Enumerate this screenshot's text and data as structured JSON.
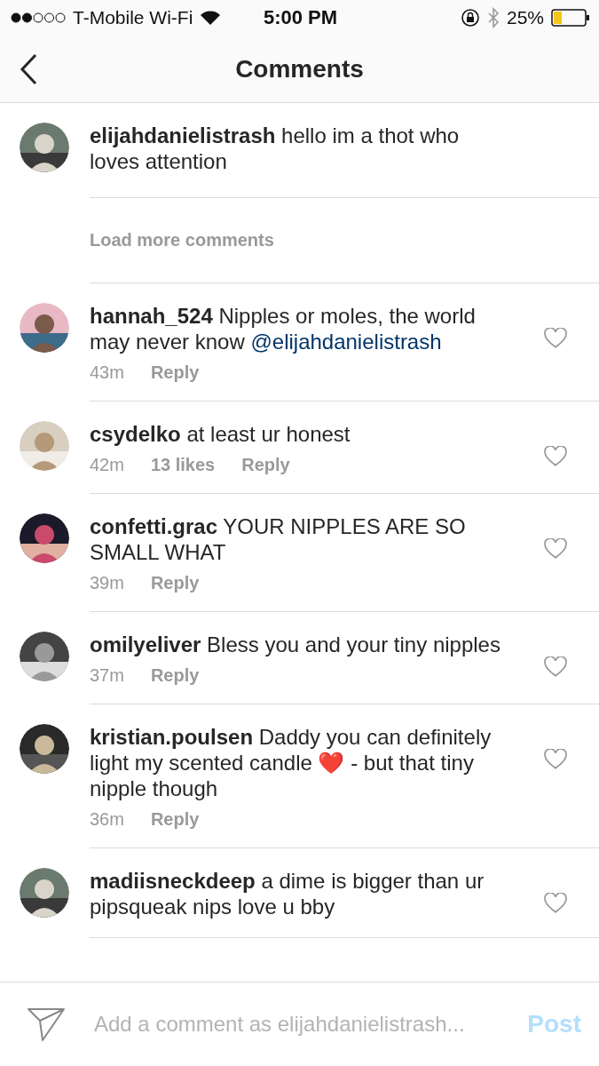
{
  "status_bar": {
    "carrier": "T-Mobile Wi-Fi",
    "time": "5:00 PM",
    "battery": "25%"
  },
  "header": {
    "title": "Comments"
  },
  "caption": {
    "username": "elijahdanielistrash",
    "text": "hello im a thot who loves attention"
  },
  "load_more": "Load more comments",
  "comments": [
    {
      "username": "hannah_524",
      "parts": [
        {
          "kind": "plain",
          "text": "Nipples or moles, the world may never know"
        },
        {
          "kind": "mention",
          "text": "@elijahdanielistrash"
        }
      ],
      "time": "43m",
      "reply": "Reply",
      "liked": false
    },
    {
      "username": "csydelko",
      "parts": [
        {
          "kind": "plain",
          "text": "at least ur honest"
        }
      ],
      "time": "42m",
      "likes": "13 likes",
      "reply": "Reply",
      "liked": false
    },
    {
      "username": "confetti.grac",
      "parts": [
        {
          "kind": "plain",
          "text": "YOUR NIPPLES ARE SO SMALL WHAT"
        }
      ],
      "time": "39m",
      "reply": "Reply",
      "liked": false
    },
    {
      "username": "omilyeliver",
      "parts": [
        {
          "kind": "plain",
          "text": "Bless you and your tiny nipples"
        }
      ],
      "time": "37m",
      "reply": "Reply",
      "liked": false
    },
    {
      "username": "kristian.poulsen",
      "parts": [
        {
          "kind": "plain",
          "text": "Daddy you can definitely light my scented candle ❤️ - but that tiny nipple though"
        }
      ],
      "time": "36m",
      "reply": "Reply",
      "liked": false
    },
    {
      "username": "madiisneckdeep",
      "parts": [
        {
          "kind": "plain",
          "text": "a dime is bigger than ur pipsqueak nips love u bby"
        }
      ],
      "liked": false
    }
  ],
  "composer": {
    "placeholder": "Add a comment as elijahdanielistrash...",
    "post": {
      "label": "Post",
      "disabled": true
    }
  }
}
